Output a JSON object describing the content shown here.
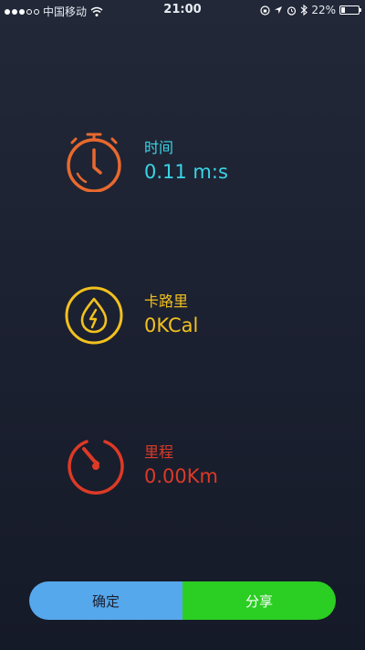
{
  "status_bar": {
    "carrier": "中国移动",
    "time": "21:00",
    "battery_text": "22%",
    "battery_level": 0.22
  },
  "stats": {
    "time": {
      "label": "时间",
      "value": "0.11 m:s"
    },
    "calories": {
      "label": "卡路里",
      "value": "0KCal"
    },
    "distance": {
      "label": "里程",
      "value": "0.00Km"
    }
  },
  "actions": {
    "confirm_label": "确定",
    "share_label": "分享"
  },
  "colors": {
    "time_accent": "#39d5e6",
    "timer_icon": "#e8692e",
    "calorie_accent": "#f2c11f",
    "distance_accent": "#dd3a26",
    "confirm_button": "#56a8ec",
    "share_button": "#2bce22"
  },
  "icons": {
    "time": "stopwatch-icon",
    "calories": "flame-icon",
    "distance": "speedometer-icon"
  }
}
